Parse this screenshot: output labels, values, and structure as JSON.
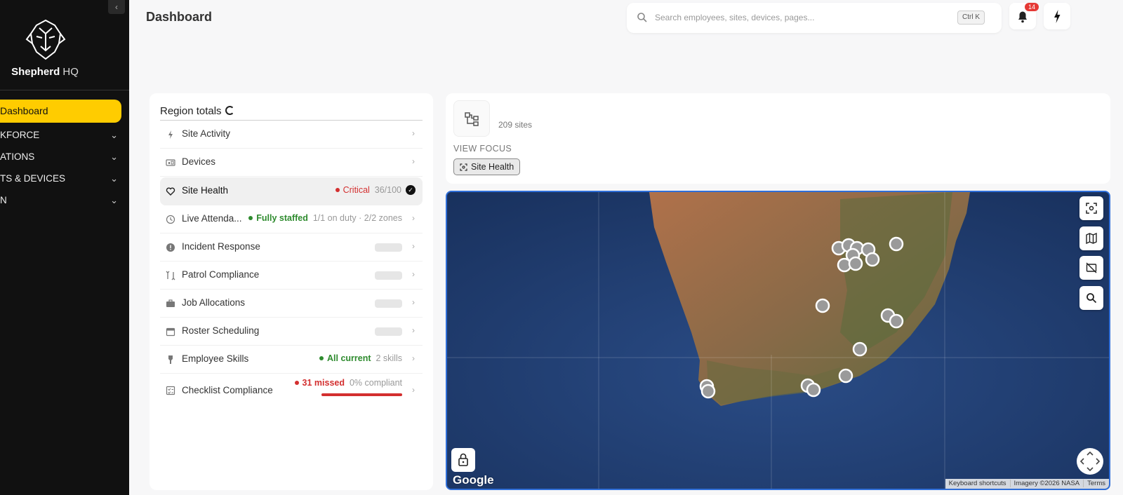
{
  "sidebar": {
    "collapse_glyph": "‹",
    "brand_bold": "Shepherd",
    "brand_rest": "HQ",
    "active_item": "Dashboard",
    "items": [
      {
        "label": "KFORCE"
      },
      {
        "label": "ATIONS"
      },
      {
        "label": "TS & DEVICES"
      },
      {
        "label": "N"
      }
    ],
    "chevron": "⌄"
  },
  "header": {
    "title": "Dashboard",
    "search_placeholder": "Search employees, sites, devices, pages...",
    "search_shortcut": "Ctrl K",
    "notification_count": "14"
  },
  "region": {
    "title": "Region totals",
    "chevron": "›",
    "rows": [
      {
        "label": "Site Activity",
        "icon": "bolt-icon"
      },
      {
        "label": "Devices",
        "icon": "devices-icon"
      },
      {
        "label": "Site Health",
        "icon": "heart-icon",
        "status": "Critical",
        "detail": "36/100",
        "status_color": "#d32f2f"
      },
      {
        "label": "Live Attenda...",
        "icon": "clock-icon",
        "status": "Fully staffed",
        "detail": "1/1 on duty · 2/2 zones",
        "status_color": "#2e8b2e"
      },
      {
        "label": "Incident Response",
        "icon": "alert-icon"
      },
      {
        "label": "Patrol Compliance",
        "icon": "patrol-icon"
      },
      {
        "label": "Job Allocations",
        "icon": "briefcase-icon"
      },
      {
        "label": "Roster Scheduling",
        "icon": "calendar-icon"
      },
      {
        "label": "Employee Skills",
        "icon": "skills-icon",
        "status": "All current",
        "detail": "2 skills",
        "status_color": "#2e8b2e"
      },
      {
        "label": "Checklist Compliance",
        "icon": "checklist-icon",
        "status": "31 missed",
        "detail": "0% compliant",
        "status_color": "#d32f2f",
        "progress": 1.0
      }
    ]
  },
  "focus": {
    "sites_count": "209 sites",
    "view_focus_label": "VIEW FOCUS",
    "chip_label": "Site Health"
  },
  "map": {
    "logo": "Google",
    "attribution": [
      "Keyboard shortcuts",
      "Imagery ©2026 NASA",
      "Terms"
    ],
    "marker_color": "#9a9a9a"
  }
}
